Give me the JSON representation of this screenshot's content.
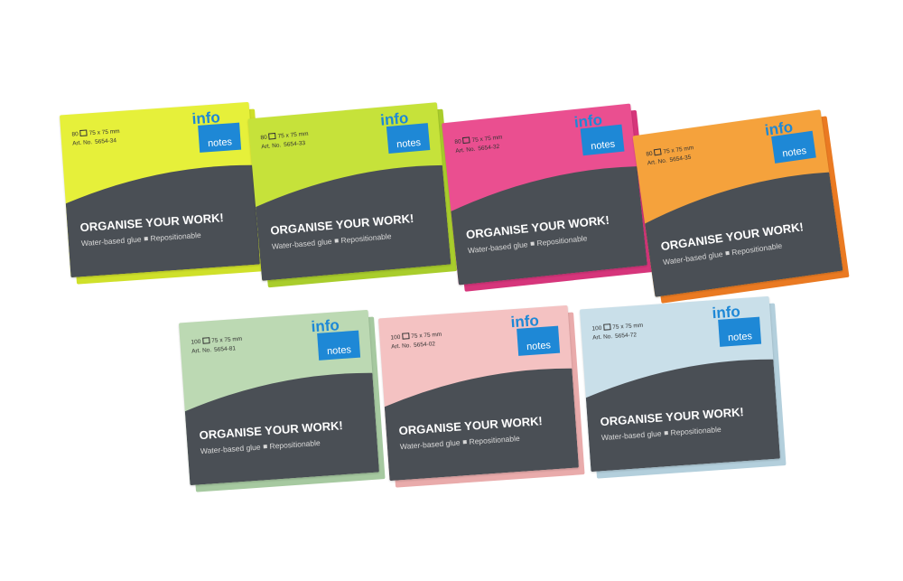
{
  "products": [
    {
      "count": "80",
      "size": "75 x 75 mm",
      "art_label": "Art. No.",
      "art": "5654-34",
      "color": "#e6f03a",
      "edge": "#cfe02a",
      "brand": "info",
      "notes": "notes",
      "slogan": "ORGANISE YOUR WORK!",
      "glue": "Water-based glue",
      "repos": "Repositionable"
    },
    {
      "count": "80",
      "size": "75 x 75 mm",
      "art_label": "Art. No.",
      "art": "5654-33",
      "color": "#c6e23a",
      "edge": "#a9cd2c",
      "brand": "info",
      "notes": "notes",
      "slogan": "ORGANISE YOUR WORK!",
      "glue": "Water-based glue",
      "repos": "Repositionable"
    },
    {
      "count": "80",
      "size": "75 x 75 mm",
      "art_label": "Art. No.",
      "art": "5654-32",
      "color": "#ea4f90",
      "edge": "#d6357b",
      "brand": "info",
      "notes": "notes",
      "slogan": "ORGANISE YOUR WORK!",
      "glue": "Water-based glue",
      "repos": "Repositionable"
    },
    {
      "count": "80",
      "size": "75 x 75 mm",
      "art_label": "Art. No.",
      "art": "5654-35",
      "color": "#f5a23c",
      "edge": "#ea7a22",
      "brand": "info",
      "notes": "notes",
      "slogan": "ORGANISE YOUR WORK!",
      "glue": "Water-based glue",
      "repos": "Repositionable"
    },
    {
      "count": "100",
      "size": "75 x 75 mm",
      "art_label": "Art. No.",
      "art": "5654-81",
      "color": "#bcd9b3",
      "edge": "#a6c9a0",
      "brand": "info",
      "notes": "notes",
      "slogan": "ORGANISE YOUR WORK!",
      "glue": "Water-based glue",
      "repos": "Repositionable"
    },
    {
      "count": "100",
      "size": "75 x 75 mm",
      "art_label": "Art. No.",
      "art": "5654-02",
      "color": "#f4c2c2",
      "edge": "#e9abab",
      "brand": "info",
      "notes": "notes",
      "slogan": "ORGANISE YOUR WORK!",
      "glue": "Water-based glue",
      "repos": "Repositionable"
    },
    {
      "count": "100",
      "size": "75 x 75 mm",
      "art_label": "Art. No.",
      "art": "5654-72",
      "color": "#c9dfe9",
      "edge": "#b3cfdc",
      "brand": "info",
      "notes": "notes",
      "slogan": "ORGANISE YOUR WORK!",
      "glue": "Water-based glue",
      "repos": "Repositionable"
    }
  ]
}
